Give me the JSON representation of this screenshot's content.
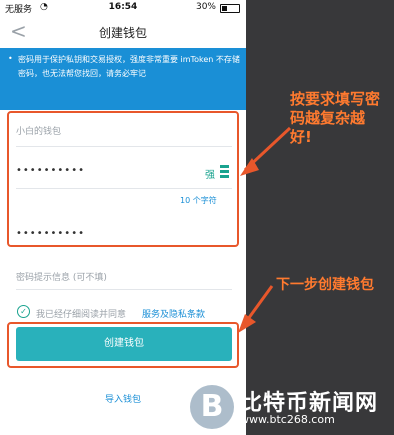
{
  "status_bar": {
    "carrier": "无服务",
    "wifi_icon": "wifi-icon",
    "time": "16:54",
    "battery": "30%"
  },
  "nav": {
    "back_icon": "<",
    "title": "创建钱包"
  },
  "banner": {
    "bullet": "•",
    "text": "密码用于保护私钥和交易授权，强度非常重要 imToken 不存储密码，也无法帮您找回，请务必牢记"
  },
  "form": {
    "wallet_name_placeholder": "小白的钱包",
    "password_value": "••••••••••",
    "strength_label": "强",
    "char_count": "10 个字符",
    "confirm_value": "••••••••••",
    "hint_placeholder": "密码提示信息 (可不填)"
  },
  "agreement": {
    "check": "✓",
    "text": "我已经仔细阅读并同意",
    "link": "服务及隐私条款"
  },
  "buttons": {
    "create": "创建钱包",
    "import": "导入钱包"
  },
  "annotations": {
    "fill_tip": "按要求填写密码越复杂越好!",
    "next_tip": "下一步创建钱包"
  },
  "watermark": {
    "logo": "B",
    "text": "比特币新闻网",
    "url": "www.btc268.com"
  },
  "colors": {
    "accent": "#1a8fd6",
    "button": "#29b1bb",
    "annotation": "#e8572b"
  }
}
